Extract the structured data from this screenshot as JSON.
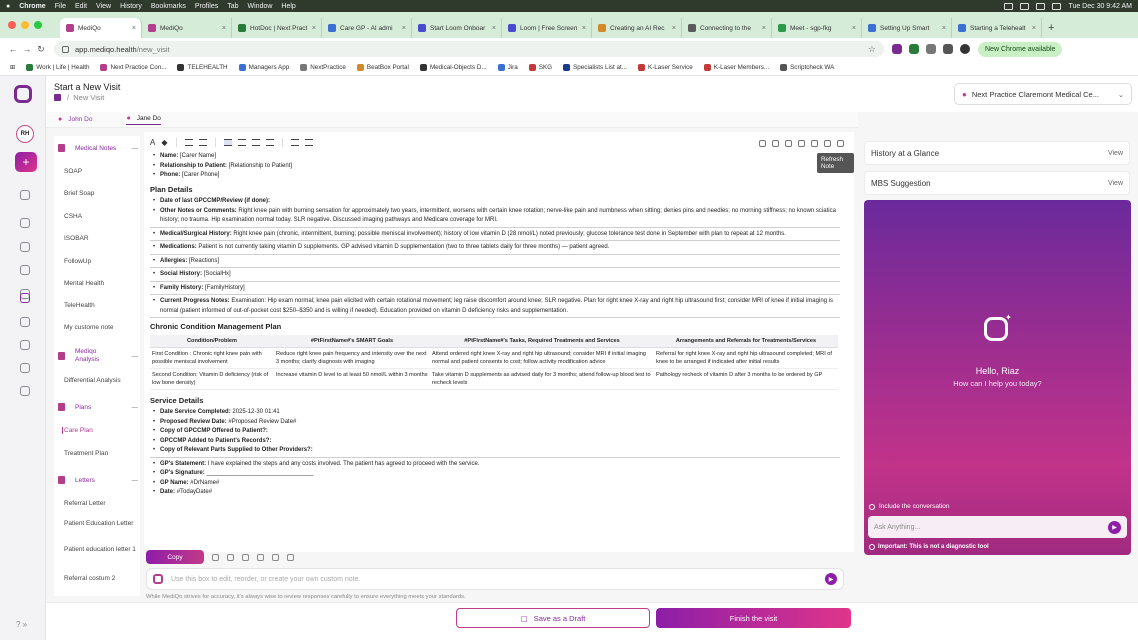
{
  "mac_menu": {
    "apple": "",
    "app": "Chrome",
    "items": [
      "File",
      "Edit",
      "View",
      "History",
      "Bookmarks",
      "Profiles",
      "Tab",
      "Window",
      "Help"
    ],
    "clock": "Tue Dec 30  9:42 AM"
  },
  "tabs": [
    {
      "label": "MediQo",
      "color": "#b33e8c",
      "active": true
    },
    {
      "label": "MediQo",
      "color": "#b33e8c"
    },
    {
      "label": "HotDoc | Next Pract",
      "color": "#2a7a3a"
    },
    {
      "label": "Care GP - AI admi",
      "color": "#3b6fd1"
    },
    {
      "label": "Start Loom Onboar",
      "color": "#4a4ad1"
    },
    {
      "label": "Loom | Free Screen",
      "color": "#4a4ad1"
    },
    {
      "label": "Creating an AI Rec",
      "color": "#d18a2a"
    },
    {
      "label": "Connecting to the",
      "color": "#5a5a5a"
    },
    {
      "label": "Meet - sgp-fkg",
      "color": "#2a9a4a"
    },
    {
      "label": "Setting Up Smart",
      "color": "#3b6fd1"
    },
    {
      "label": "Starting a Telehealt",
      "color": "#3b6fd1"
    }
  ],
  "address": {
    "domain": "app.mediqo.health",
    "path": "/new_visit",
    "new_chrome": "New Chrome available"
  },
  "bookmarks": [
    "Work | Life | Health",
    "Next Practice Con...",
    "TELEHEALTH",
    "Managers App",
    "NextPractice",
    "BeatBox Portal",
    "Medical-Objects D...",
    "Jira",
    "SKG",
    "Specialists List at...",
    "K-Laser Service",
    "K-Laser Members...",
    "Scriptcheck WA"
  ],
  "header": {
    "title": "Start a New Visit",
    "crumb": "New Visit",
    "clinic": "Next Practice Claremont Medical Ce..."
  },
  "patient_tabs": [
    "John Do",
    "Jane Do"
  ],
  "rail": {
    "avatar": "RH"
  },
  "sidenav": {
    "groups": [
      {
        "label": "Medical Notes",
        "items": [
          "SOAP",
          "Brief Soap",
          "CSHA",
          "ISOBAR",
          "FollowUp",
          "Mental Health",
          "TeleHealth",
          "My custome note"
        ]
      },
      {
        "label": "Mediqo Analysis",
        "items": [
          "Differential Analysis"
        ]
      },
      {
        "label": "Plans",
        "items": [
          "Care Plan",
          "Treatment Plan"
        ]
      },
      {
        "label": "Letters",
        "items": [
          "Referral Letter",
          "Patient Education Letter",
          "Patient education letter 1",
          "Referral costum 2"
        ]
      }
    ]
  },
  "toolbar": {
    "tooltip": "Refresh Note"
  },
  "doc": {
    "carer_name_label": "Name:",
    "carer_name_value": "[Carer Name]",
    "rel_label": "Relationship to Patient:",
    "rel_value": "[Relationship to Patient]",
    "phone_label": "Phone:",
    "phone_value": "[Carer Phone]",
    "plan_details": "Plan Details",
    "last_review": "Date of last GPCCMP/Review (if done):",
    "other_notes_label": "Other Notes or Comments:",
    "other_notes": "Right knee pain with burning sensation for approximately two years, intermittent, worsens with certain knee rotation; nerve-like pain and numbness when sitting; denies pins and needles; no morning stiffness; no known sciatica history; no trauma. Hip examination normal today. SLR negative. Discussed imaging pathways and Medicare coverage for MRI.",
    "med_hist_label": "Medical/Surgical History:",
    "med_hist": "Right knee pain (chronic, intermittent, burning; possible meniscal involvement); history of low vitamin D (28 nmol/L) noted previously; glucose tolerance test done in September with plan to repeat at 12 months.",
    "meds_label": "Medications:",
    "meds": "Patient is not currently taking vitamin D supplements. GP advised vitamin D supplementation (two to three tablets daily for three months) — patient agreed.",
    "allergies_label": "Allergies:",
    "allergies": "[Reactions]",
    "social_label": "Social History:",
    "social": "[SocialHx]",
    "family_label": "Family History:",
    "family": "[FamilyHistory]",
    "progress_label": "Current Progress Notes:",
    "progress": "Examination: Hip exam normal; knee pain elicited with certain rotational movement; leg raise discomfort around knee; SLR negative. Plan for right knee X-ray and right hip ultrasound first; consider MRI of knee if initial imaging is normal (patient informed of out-of-pocket cost $250–$350 and is willing if needed). Education provided on vitamin D deficiency risks and supplementation.",
    "ccm_title": "Chronic Condition Management Plan",
    "table_headers": [
      "Condition/Problem",
      "#PtFirstName#'s SMART Goals",
      "#PtFirstName#'s Tasks, Required Treatments and Services",
      "Arrangements and Referrals for Treatments/Services"
    ],
    "table_rows": [
      [
        "First Condition : Chronic right knee pain with possible meniscal involvement",
        "Reduce right knee pain frequency and intensity over the next 3 months; clarify diagnosis with imaging",
        "Attend ordered right knee X-ray and right hip ultrasound; consider MRI if initial imaging normal and patient consents to cost; follow activity modification advice",
        "Referral for right knee X-ray and right hip ultrasound completed; MRI of knee to be arranged if indicated after initial results"
      ],
      [
        "Second Condition: Vitamin D deficiency (risk of low bone density)",
        "Increase vitamin D level to at least 50 nmol/L within 3 months",
        "Take vitamin D supplements as advised daily for 3 months; attend follow-up blood test to recheck levels",
        "Pathology recheck of vitamin D after 3 months to be ordered by GP"
      ]
    ],
    "service_title": "Service Details",
    "dsc_label": "Date Service Completed:",
    "dsc": "2025-12-30 01:41",
    "prd_label": "Proposed Review Date:",
    "prd": "#Proposed Review Date#",
    "copy_offered": "Copy of GPCCMP Offered to Patient?:",
    "added_records": "GPCCMP Added to Patient's Records?:",
    "copy_supplied": "Copy of Relevant Parts Supplied to Other Providers?:",
    "gp_statement_label": "GP's Statement:",
    "gp_statement": "I have explained the steps and any costs involved. The patient has agreed to proceed with the service.",
    "gp_sig_label": "GP's Signature:",
    "gp_sig": "________________________________",
    "gp_name_label": "GP Name:",
    "gp_name": "#DrName#",
    "date_label": "Date:",
    "date": "#TodayDate#"
  },
  "editor_footer": {
    "copy": "Copy",
    "note_placeholder": "Use this box to edit, reorder, or create your own custom note.",
    "disclaimer": "While MediQo strives for accuracy, it's always wise to review responses carefully to ensure everything meets your standards."
  },
  "actions": {
    "draft": "Save as a Draft",
    "finish": "Finish the visit"
  },
  "right": {
    "history": "History at a Glance",
    "mbs": "MBS Suggestion",
    "view": "View",
    "hello": "Hello, Riaz",
    "help": "How can I help you today?",
    "include": "Include the conversation",
    "ask": "Ask Anything...",
    "important": "Important: This is not a diagnostic tool"
  }
}
